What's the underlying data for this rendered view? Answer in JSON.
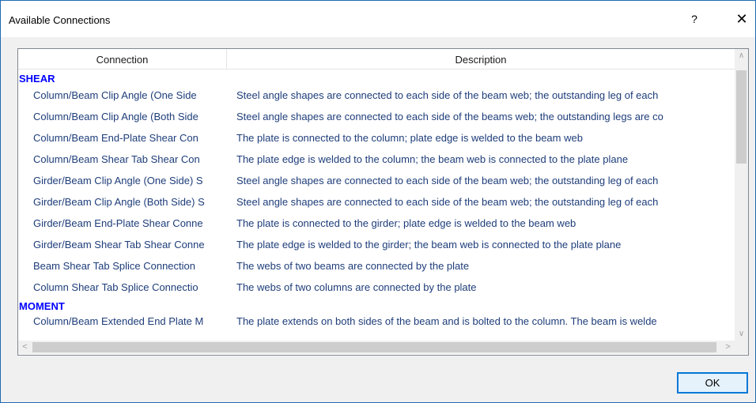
{
  "window": {
    "title": "Available Connections",
    "help_label": "?",
    "close_label": "✕",
    "ok_label": "OK"
  },
  "columns": {
    "connection": "Connection",
    "description": "Description"
  },
  "groups": {
    "shear": {
      "label": "SHEAR",
      "rows": [
        {
          "connection": "Column/Beam Clip Angle (One Side",
          "description": "Steel angle shapes are connected to each side of the beam web; the outstanding leg of each"
        },
        {
          "connection": "Column/Beam Clip Angle (Both Side",
          "description": "Steel angle shapes are connected to each side of the beams web; the outstanding legs are co"
        },
        {
          "connection": "Column/Beam End-Plate Shear Con",
          "description": "The plate is connected to the column; plate edge is welded to the beam web"
        },
        {
          "connection": "Column/Beam Shear Tab Shear Con",
          "description": "The plate edge is welded to the column; the beam web is connected to the plate plane"
        },
        {
          "connection": "Girder/Beam Clip Angle (One Side) S",
          "description": "Steel angle shapes are connected to each side of the beam web; the outstanding leg of each"
        },
        {
          "connection": "Girder/Beam Clip Angle (Both Side) S",
          "description": "Steel angle shapes are connected to each side of the beam web; the outstanding leg of each"
        },
        {
          "connection": "Girder/Beam End-Plate Shear Conne",
          "description": "The plate is connected to the girder; plate edge is welded to the beam web"
        },
        {
          "connection": "Girder/Beam Shear Tab Shear Conne",
          "description": "The plate edge is welded to the girder; the beam web is connected to the plate plane"
        },
        {
          "connection": "Beam Shear Tab Splice Connection",
          "description": "The webs of two beams are connected by the plate"
        },
        {
          "connection": "Column Shear Tab Splice Connectio",
          "description": "The webs of two columns are connected by the plate"
        }
      ]
    },
    "moment": {
      "label": "MOMENT",
      "rows": [
        {
          "connection": "Column/Beam Extended End Plate M",
          "description": "The plate extends on both sides of the beam and is bolted to the column.  The beam is welde"
        }
      ]
    }
  },
  "scrollbars": {
    "up": "∧",
    "down": "∨",
    "left": "<",
    "right": ">"
  }
}
